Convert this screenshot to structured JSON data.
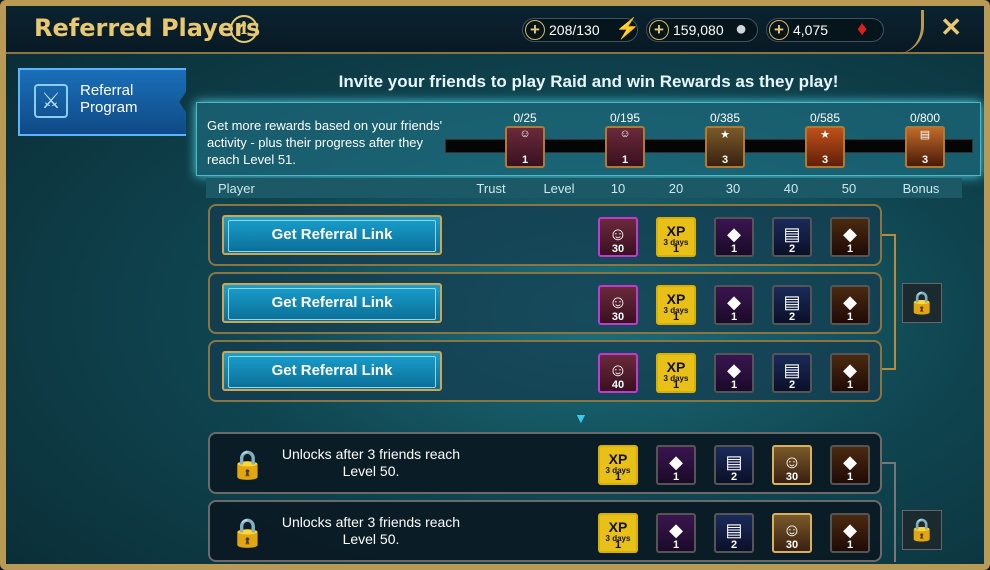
{
  "header": {
    "title": "Referred Players",
    "info_label": "i",
    "resources": [
      {
        "icon": "energy-icon",
        "value": "208/130",
        "plus": "+"
      },
      {
        "icon": "silver-icon",
        "value": "159,080",
        "plus": "+"
      },
      {
        "icon": "gem-icon",
        "value": "4,075",
        "plus": "+"
      }
    ],
    "close_label": "✕"
  },
  "sidebar": {
    "items": [
      {
        "label": "Referral Program",
        "icon": "referral-icon"
      }
    ]
  },
  "invite_text": "Invite your friends to play Raid and win Rewards as they play!",
  "progress": {
    "description": "Get more rewards based on your friends' activity - plus their progress after they reach Level 51.",
    "milestones": [
      {
        "count": "0/25",
        "qty": "1"
      },
      {
        "count": "0/195",
        "qty": "1"
      },
      {
        "count": "0/385",
        "qty": "3"
      },
      {
        "count": "0/585",
        "qty": "3"
      },
      {
        "count": "0/800",
        "qty": "3"
      }
    ]
  },
  "columns": [
    "Player",
    "Trust",
    "Level",
    "10",
    "20",
    "30",
    "40",
    "50",
    "Bonus"
  ],
  "rows": [
    {
      "button": "Get Referral Link",
      "rewards": [
        "30",
        "1",
        "1",
        "2",
        "1"
      ],
      "xp": "XP",
      "xp_days": "3 days"
    },
    {
      "button": "Get Referral Link",
      "rewards": [
        "30",
        "1",
        "1",
        "2",
        "1"
      ],
      "xp": "XP",
      "xp_days": "3 days"
    },
    {
      "button": "Get Referral Link",
      "rewards": [
        "40",
        "1",
        "1",
        "2",
        "1"
      ],
      "xp": "XP",
      "xp_days": "3 days"
    }
  ],
  "locked_rows": [
    {
      "text": "Unlocks after 3 friends reach Level 50.",
      "rewards": [
        "1",
        "1",
        "2",
        "30",
        "1"
      ],
      "xp": "XP",
      "xp_days": "3 days"
    },
    {
      "text": "Unlocks after 3 friends reach Level 50.",
      "rewards": [
        "1",
        "1",
        "2",
        "30",
        "1"
      ],
      "xp": "XP",
      "xp_days": "3 days"
    }
  ],
  "colors": {
    "gold": "#e8c870",
    "accent": "#3cd3ff",
    "button": "#1aa0cf"
  }
}
